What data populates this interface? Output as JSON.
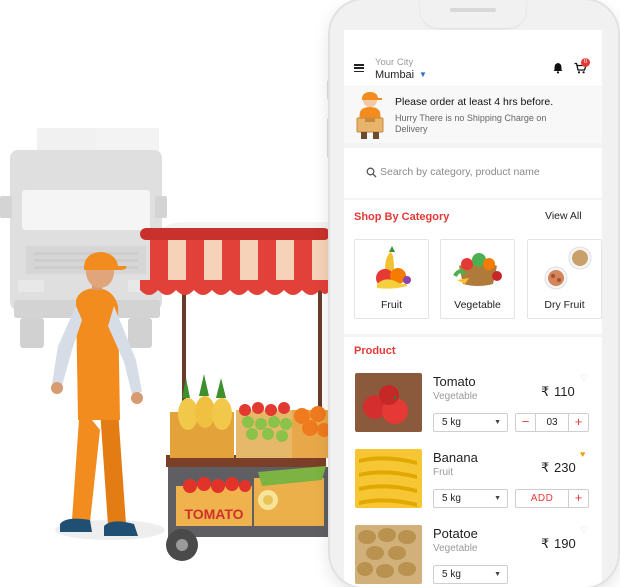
{
  "header": {
    "city_label": "Your City",
    "city_name": "Mumbai",
    "cart_count": "0"
  },
  "notice": {
    "title": "Please order at least 4 hrs before.",
    "subtitle": "Hurry There is no Shipping Charge on Delivery"
  },
  "search": {
    "placeholder": "Search by category, product name"
  },
  "categories": {
    "title": "Shop By Category",
    "view_all": "View All",
    "items": [
      {
        "label": "Fruit"
      },
      {
        "label": "Vegetable"
      },
      {
        "label": "Dry Fruit"
      }
    ]
  },
  "products": {
    "title": "Product",
    "items": [
      {
        "name": "Tomato",
        "category": "Vegetable",
        "currency": "₹",
        "price": "110",
        "unit": "5 kg",
        "quantity": "03",
        "favorite": false
      },
      {
        "name": "Banana",
        "category": "Fruit",
        "currency": "₹",
        "price": "230",
        "unit": "5 kg",
        "add_label": "ADD",
        "favorite": true
      },
      {
        "name": "Potatoe",
        "category": "Vegetable",
        "currency": "₹",
        "price": "190",
        "unit": "5 kg",
        "favorite": false
      }
    ]
  },
  "illustration": {
    "crate_text": "TOMATO"
  },
  "colors": {
    "accent": "#e53935",
    "worker": "#f28c1e",
    "favorite": "#f39c12"
  }
}
